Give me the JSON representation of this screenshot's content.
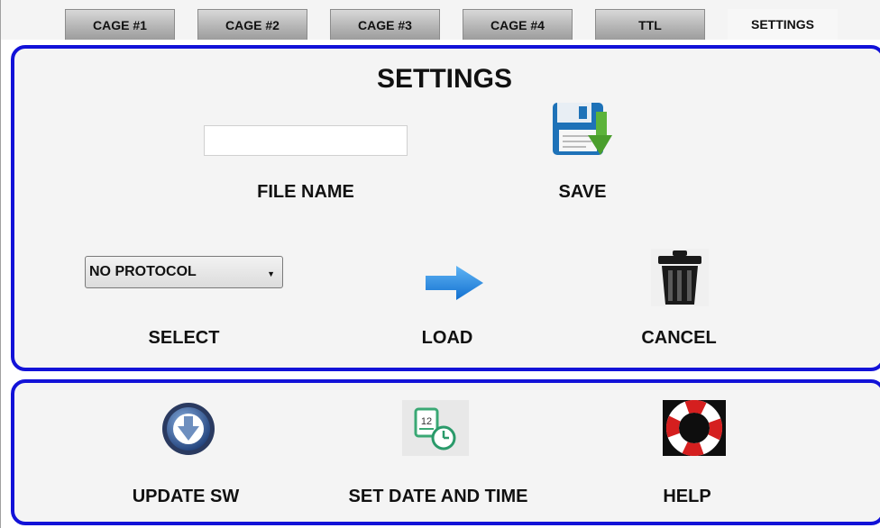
{
  "tabs": [
    {
      "label": "CAGE #1",
      "active": false
    },
    {
      "label": "CAGE #2",
      "active": false
    },
    {
      "label": "CAGE #3",
      "active": false
    },
    {
      "label": "CAGE #4",
      "active": false
    },
    {
      "label": "TTL",
      "active": false
    },
    {
      "label": "SETTINGS",
      "active": true
    }
  ],
  "settings": {
    "title": "SETTINGS",
    "file_name_label": "FILE NAME",
    "file_name_value": "",
    "save_label": "SAVE",
    "protocol_selected": "NO PROTOCOL",
    "select_label": "SELECT",
    "load_label": "LOAD",
    "cancel_label": "CANCEL"
  },
  "tools": {
    "update_label": "UPDATE SW",
    "datetime_label": "SET DATE AND TIME",
    "calendar_number": "12",
    "help_label": "HELP"
  },
  "colors": {
    "panel_border": "#1212d8",
    "panel_bg": "#f4f4f4",
    "save_arrow": "#5cb33a",
    "load_arrow": "#1a86e0",
    "help_ring": "#d51f1f"
  },
  "icons": [
    "floppy-save-icon",
    "arrow-right-icon",
    "trash-icon",
    "download-circle-icon",
    "calendar-clock-icon",
    "lifebuoy-icon"
  ]
}
